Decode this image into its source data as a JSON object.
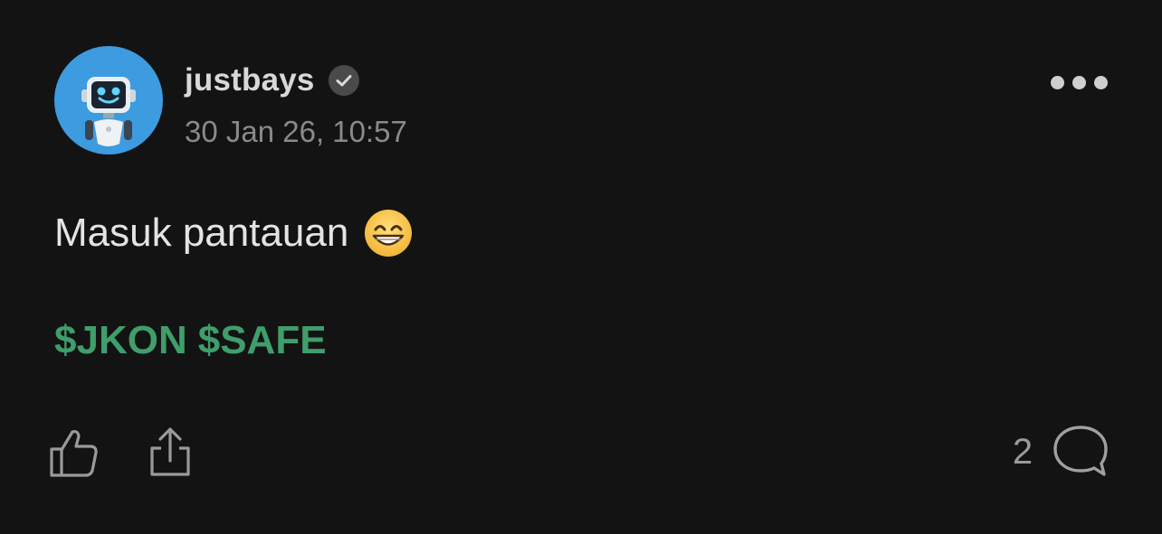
{
  "post": {
    "author": {
      "username": "justbays",
      "verified": true,
      "avatar": "robot-avatar"
    },
    "timestamp": "30 Jan 26, 10:57",
    "text": "Masuk pantauan",
    "emoji": "grinning-face-with-smiling-eyes",
    "tickers": [
      "$JKON",
      "$SAFE"
    ],
    "comment_count": "2",
    "icons": {
      "more": "more-options-icon",
      "like": "thumbs-up-icon",
      "share": "share-icon",
      "comment": "comment-bubble-icon",
      "verified": "verified-badge-icon"
    }
  },
  "colors": {
    "background": "#131313",
    "ticker": "#3f9e6b",
    "avatar_bg": "#3d9be0",
    "muted_text": "#8a8a8a"
  }
}
